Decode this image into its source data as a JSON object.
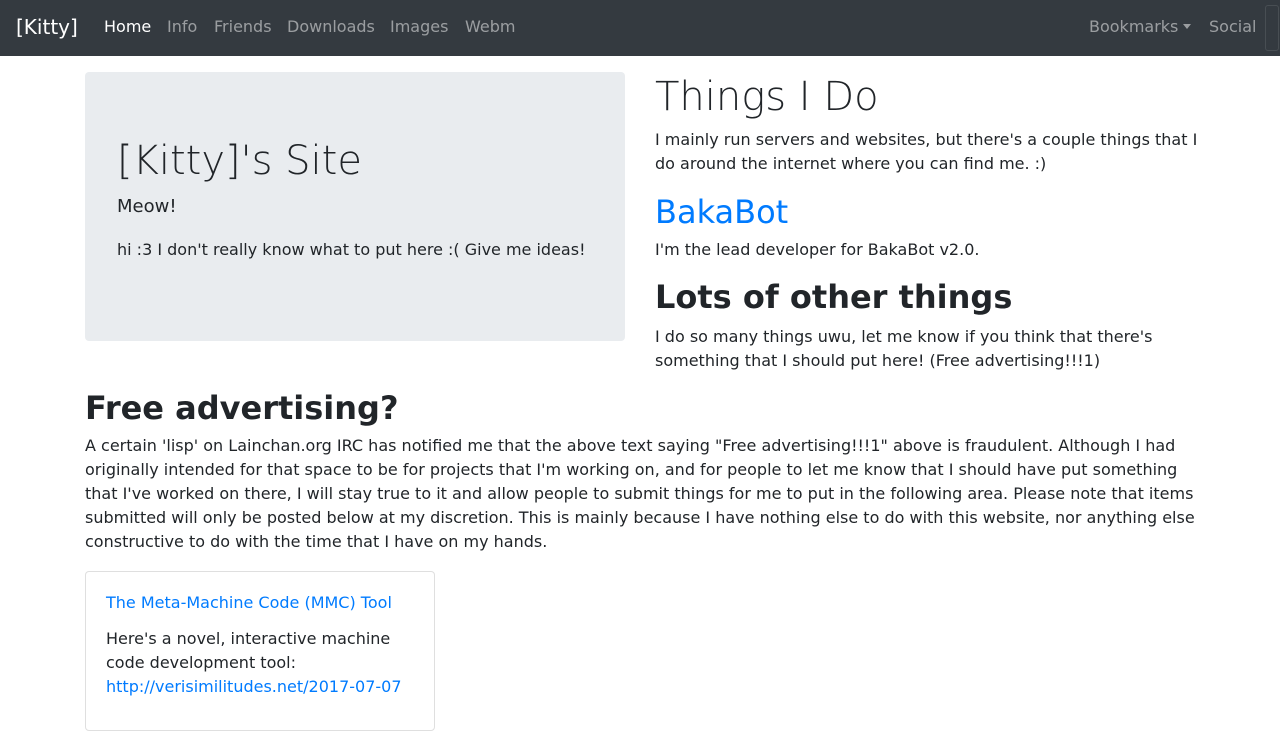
{
  "navbar": {
    "brand": "[Kitty]",
    "items": [
      {
        "label": "Home"
      },
      {
        "label": "Info"
      },
      {
        "label": "Friends"
      },
      {
        "label": "Downloads"
      },
      {
        "label": "Images"
      },
      {
        "label": "Webm"
      }
    ],
    "bookmarks_label": "Bookmarks",
    "social_label": "Social"
  },
  "jumbotron": {
    "title": "[Kitty]'s Site",
    "subtitle": "Meow!",
    "lead": "hi :3 I don't really know what to put here :( Give me ideas!"
  },
  "things": {
    "heading": "Things I Do",
    "intro_lines": [
      "I mainly run servers and websites, but there's a couple things that I",
      "do around the internet where you can find me. :)"
    ],
    "bakabot_heading": "BakaBot",
    "bakabot_text": "I'm the lead developer for BakaBot v2.0.",
    "lots_heading": "Lots of other things",
    "lots_lines": [
      "I do so many things uwu, let me know if you think that there's",
      "something that I should put here! (Free advertising!!!1)"
    ]
  },
  "free": {
    "heading": "Free advertising?",
    "lines": [
      "A certain 'lisp' on Lainchan.org IRC has notified me that the above text saying \"Free advertising!!!1\" above is fraudulent. Although I had",
      "originally intended for that space to be for projects that I'm working on, and for people to let me know that I should have put something",
      "that I've worked on there, I will stay true to it and allow people to submit things for me to put in the following area. Please note that items",
      "submitted will only be posted below at my discretion. This is mainly because I have nothing else to do with this website, nor anything else",
      "constructive to do with the time that I have on my hands."
    ]
  },
  "card": {
    "title": "The Meta-Machine Code (MMC) Tool",
    "text_lines": [
      "Here's a novel, interactive machine",
      "code development tool:"
    ],
    "url": "http://verisimilitudes.net/2017-07-07"
  }
}
